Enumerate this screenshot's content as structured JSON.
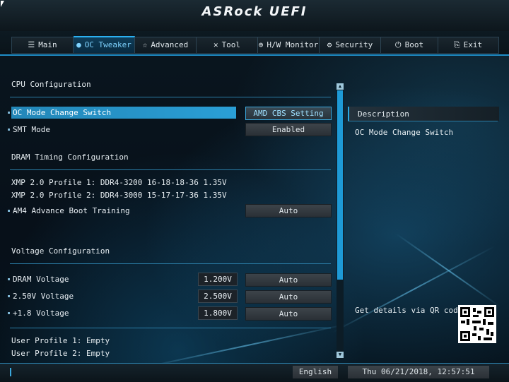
{
  "header": {
    "brand": "ASRock UEFI"
  },
  "tabs": [
    {
      "label": "Main",
      "icon": "list-icon",
      "glyph": "☰"
    },
    {
      "label": "OC Tweaker",
      "icon": "flame-icon",
      "glyph": "🔥",
      "active": true
    },
    {
      "label": "Advanced",
      "icon": "star-icon",
      "glyph": "☆"
    },
    {
      "label": "Tool",
      "icon": "tools-icon",
      "glyph": "✕"
    },
    {
      "label": "H/W Monitor",
      "icon": "monitor-icon",
      "glyph": "⊕"
    },
    {
      "label": "Security",
      "icon": "shield-icon",
      "glyph": "⚙"
    },
    {
      "label": "Boot",
      "icon": "power-icon",
      "glyph": "⏻"
    },
    {
      "label": "Exit",
      "icon": "exit-icon",
      "glyph": "⎘"
    }
  ],
  "cpu": {
    "heading": "CPU Configuration",
    "oc_mode_label": "OC Mode Change Switch",
    "oc_mode_value": "AMD CBS Setting",
    "smt_label": "SMT Mode",
    "smt_value": "Enabled"
  },
  "dram": {
    "heading": "DRAM Timing Configuration",
    "xmp1": "XMP 2.0 Profile 1: DDR4-3200 16-18-18-36 1.35V",
    "xmp2": "XMP 2.0 Profile 2: DDR4-3000 15-17-17-36 1.35V",
    "boot_training_label": "AM4 Advance Boot Training",
    "boot_training_value": "Auto"
  },
  "voltage": {
    "heading": "Voltage Configuration",
    "rows": [
      {
        "label": "DRAM Voltage",
        "reading": "1.200V",
        "value": "Auto"
      },
      {
        "label": "2.50V Voltage",
        "reading": "2.500V",
        "value": "Auto"
      },
      {
        "label": "+1.8 Voltage",
        "reading": "1.800V",
        "value": "Auto"
      }
    ]
  },
  "profiles": {
    "p1": "User Profile 1: Empty",
    "p2": "User Profile 2: Empty"
  },
  "description": {
    "title": "Description",
    "text": "OC Mode Change Switch",
    "qr_label": "Get details via QR code"
  },
  "footer": {
    "language": "English",
    "datetime": "Thu 06/21/2018, 12:57:51"
  },
  "colors": {
    "accent": "#2aa6e0",
    "highlight": "#2387b8",
    "background": "#06121b"
  }
}
